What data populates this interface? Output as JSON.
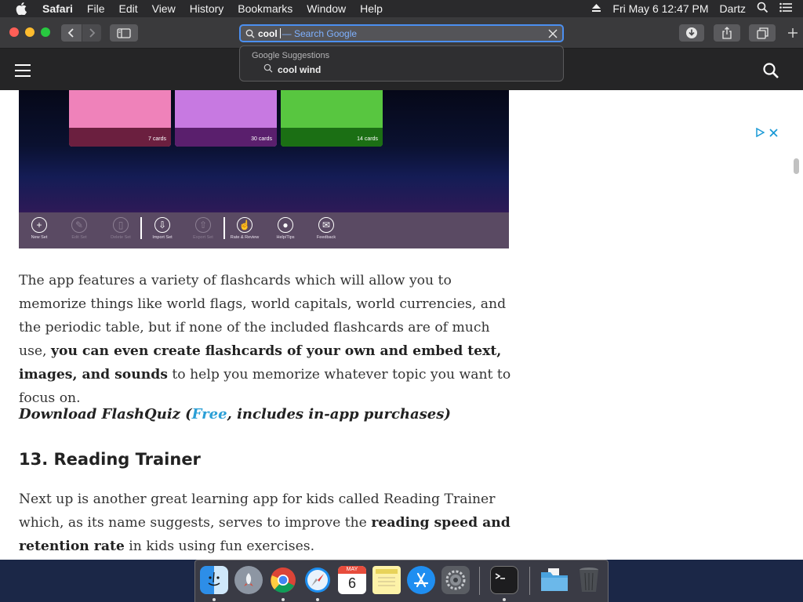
{
  "menubar": {
    "app_name": "Safari",
    "items": [
      "File",
      "Edit",
      "View",
      "History",
      "Bookmarks",
      "Window",
      "Help"
    ],
    "clock": "Fri May 6  12:47 PM",
    "user": "Dartz"
  },
  "address_bar": {
    "typed": "cool",
    "suggestion_hint": "— Search Google"
  },
  "suggestions": {
    "header": "Google Suggestions",
    "items": [
      "cool wind"
    ]
  },
  "article": {
    "image": {
      "cards": [
        "7 cards",
        "30 cards",
        "14 cards"
      ],
      "appbar": [
        "New Set",
        "Edit Set",
        "Delete Set",
        "Import Set",
        "Export Set",
        "Rate & Review",
        "Help/Tips",
        "Feedback"
      ]
    },
    "p1": {
      "text_a": "The app features a variety of flashcards which will allow you to memorize things like world flags, world capitals, world currencies, and the periodic table, but if none of the included flashcards are of much use, ",
      "bold": "you can even create flashcards of your own and embed text, images, and sounds",
      "text_b": " to help you memorize whatever topic you want to focus on."
    },
    "download": {
      "prefix": "Download FlashQuiz (",
      "link": "Free",
      "suffix": ", includes in-app purchases)"
    },
    "heading": "13. Reading Trainer",
    "p2": {
      "text_a": "Next up is another great learning app for kids called Reading Trainer which, as its name suggests, serves to improve the ",
      "bold": "reading speed and retention rate",
      "text_b": " in kids using fun exercises."
    }
  },
  "dock": {
    "apps": [
      "Finder",
      "Launchpad",
      "Chrome",
      "Safari",
      "Calendar",
      "Notes",
      "App Store",
      "System Preferences",
      "Terminal",
      "Documents",
      "Trash"
    ],
    "calendar_month": "MAY",
    "calendar_day": "6"
  },
  "colors": {
    "accent_blue": "#4b8ff0",
    "link_blue": "#2a9fd6",
    "menubar_bg": "#2a2a2c",
    "toolbar_bg": "#3a3a3c"
  }
}
